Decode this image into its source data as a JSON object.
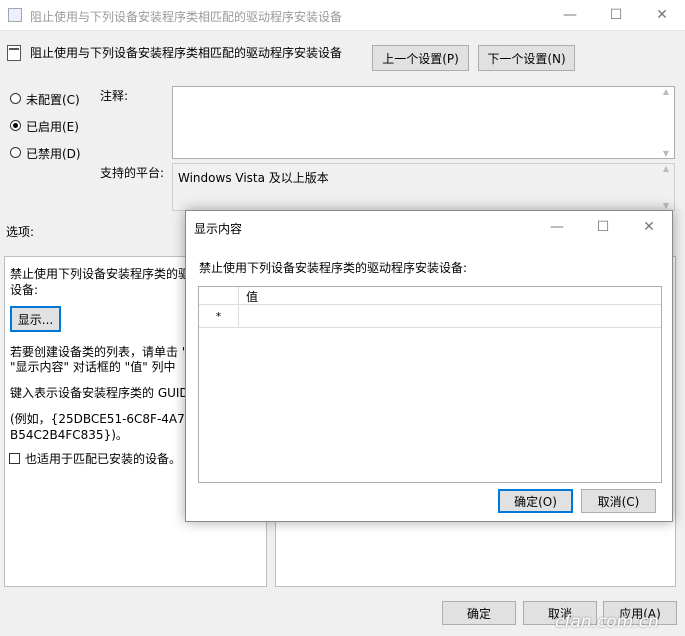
{
  "window": {
    "title": "阻止使用与下列设备安装程序类相匹配的驱动程序安装设备"
  },
  "header": {
    "setting_title": "阻止使用与下列设备安装程序类相匹配的驱动程序安装设备",
    "prev_button": "上一个设置(P)",
    "next_button": "下一个设置(N)"
  },
  "state": {
    "options": [
      {
        "label": "未配置(C)",
        "selected": false
      },
      {
        "label": "已启用(E)",
        "selected": true
      },
      {
        "label": "已禁用(D)",
        "selected": false
      }
    ]
  },
  "comment": {
    "label": "注释:",
    "value": ""
  },
  "platform": {
    "label": "支持的平台:",
    "value": "Windows Vista 及以上版本"
  },
  "options_panel": {
    "label": "选项:",
    "line1": "禁止使用下列设备安装程序类的驱",
    "line2": "设备:",
    "show_button": "显示...",
    "hint1": "若要创建设备类的列表，请单击 \"",
    "hint2": "\"显示内容\" 对话框的 \"值\" 列中",
    "hint3": "键入表示设备安装程序类的 GUID",
    "example1": "(例如，{25DBCE51-6C8F-4A72-",
    "example2": "B54C2B4FC835})。",
    "checkbox_label": "也适用于匹配已安装的设备。"
  },
  "dialog": {
    "title": "显示内容",
    "prompt": "禁止使用下列设备安装程序类的驱动程序安装设备:",
    "column_header": "值",
    "new_row_marker": "*",
    "ok_button": "确定(O)",
    "cancel_button": "取消(C)"
  },
  "footer": {
    "ok": "确定",
    "cancel": "取消",
    "apply": "应用(A)"
  },
  "watermark": "cfan.com.cn",
  "colors": {
    "accent": "#0078d7",
    "window_bg": "#f0f0f0",
    "button_bg": "#e1e1e1"
  }
}
